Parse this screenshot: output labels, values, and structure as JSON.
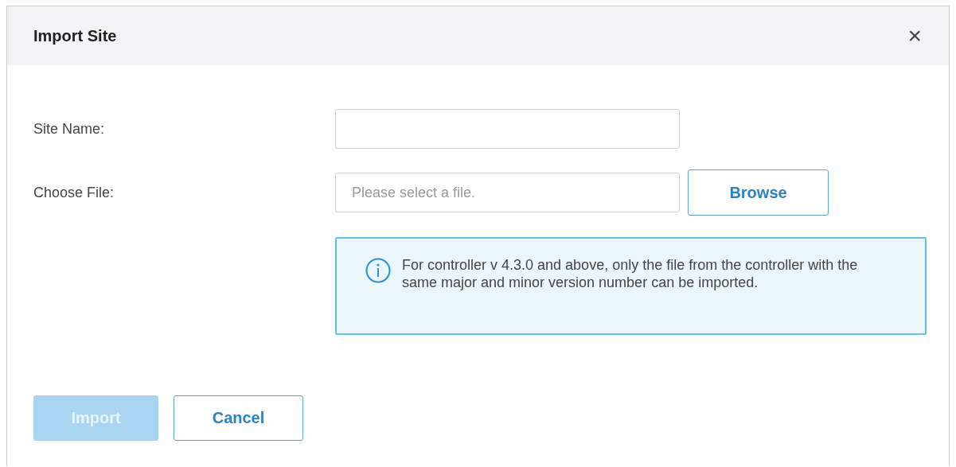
{
  "window": {
    "title": "Import Site",
    "close": "×"
  },
  "fields": [
    {
      "kind": "text",
      "label": "Site Name:"
    },
    {
      "kind": "file",
      "label": "Choose File:",
      "placeholder": "Please select a file.",
      "button": "Browse"
    }
  ],
  "info": {
    "text": "For controller v 4.3.0 and above, only the file from the controller with the same major and minor version number can be imported."
  },
  "buttons": [
    {
      "label": "Import",
      "kind": "primary",
      "disabled": true
    },
    {
      "label": "Cancel",
      "kind": "secondary",
      "disabled": false
    }
  ]
}
